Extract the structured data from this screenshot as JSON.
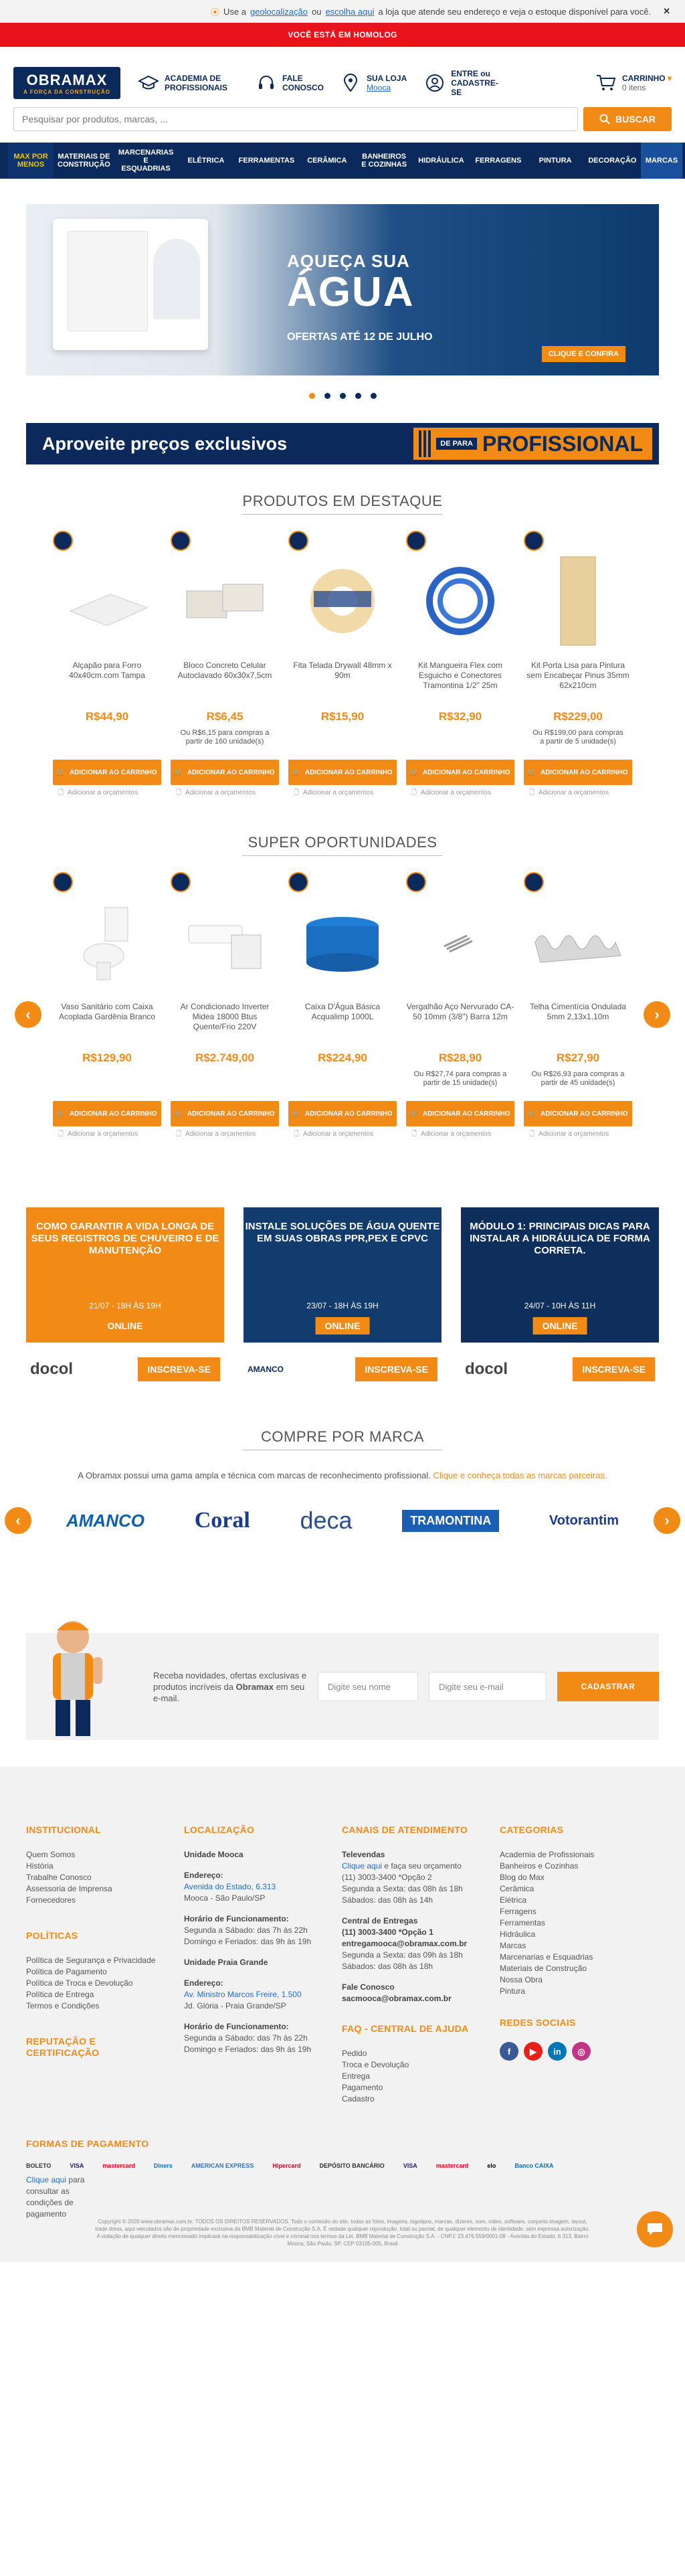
{
  "topbar": {
    "pre": "Use a",
    "geo": "geolocalização",
    "mid": "ou",
    "choose": "escolha aqui",
    "post": "a loja que atende seu endereço e veja o estoque disponível para você."
  },
  "homolog": "VOCÊ ESTÁ EM HOMOLOG",
  "header": {
    "logo": "OBRAMAX",
    "logo_sub": "A FORÇA DA CONSTRUÇÃO",
    "academia": "ACADEMIA DE PROFISSIONAIS",
    "fale": "FALE CONOSCO",
    "loja_label": "SUA LOJA",
    "loja_value": "Mooca",
    "entre": "ENTRE ou CADASTRE-SE",
    "cart_label": "CARRINHO",
    "cart_count": "0 itens"
  },
  "search": {
    "placeholder": "Pesquisar por produtos, marcas, ...",
    "button": "BUSCAR"
  },
  "nav": [
    "MAX POR MENOS",
    "MATERIAIS DE CONSTRUÇÃO",
    "MARCENARIAS E ESQUADRIAS",
    "ELÉTRICA",
    "FERRAMENTAS",
    "CERÂMICA",
    "BANHEIROS E COZINHAS",
    "HIDRÁULICA",
    "FERRAGENS",
    "PINTURA",
    "DECORAÇÃO",
    "MARCAS"
  ],
  "banner": {
    "t1": "AQUEÇA SUA",
    "t2": "ÁGUA",
    "t3": "OFERTAS ATÉ 12 DE JULHO",
    "cta": "CLIQUE E CONFIRA"
  },
  "pro_banner": {
    "text": "Aproveite preços exclusivos",
    "de": "DE PARA",
    "pro": "PROFISSIONAL"
  },
  "destaque": {
    "title": "PRODUTOS EM DESTAQUE",
    "products": [
      {
        "name": "Alçapão para Forro 40x40cm.com Tampa",
        "price": "R$44,90",
        "bulk1": "",
        "bulk2": ""
      },
      {
        "name": "Bloco Concreto Celular Autoclavado 60x30x7,5cm",
        "price": "R$6,45",
        "bulk1": "Ou R$6,15 para compras a",
        "bulk2": "partir de 160 unidade(s)"
      },
      {
        "name": "Fita Telada Drywall 48mm x 90m",
        "price": "R$15,90",
        "bulk1": "",
        "bulk2": ""
      },
      {
        "name": "Kit Mangueira Flex com Esguicho e Conectores Tramontina 1/2\" 25m",
        "price": "R$32,90",
        "bulk1": "",
        "bulk2": ""
      },
      {
        "name": "Kit Porta Lisa para Pintura sem Encabeçar Pinus 35mm 62x210cm",
        "price": "R$229,00",
        "bulk1": "Ou R$199,00 para compras",
        "bulk2": "a partir de 5 unidade(s)"
      }
    ],
    "add_label": "ADICIONAR AO CARRINHO",
    "quote_label": "Adicionar a orçamentos"
  },
  "oport": {
    "title": "SUPER OPORTUNIDADES",
    "products": [
      {
        "name": "Vaso Sanitário com Caixa Acoplada Gardênia Branco",
        "price": "R$129,90",
        "bulk1": "",
        "bulk2": ""
      },
      {
        "name": "Ar Condicionado Inverter Midea 18000 Btus Quente/Frio 220V",
        "price": "R$2.749,00",
        "bulk1": "",
        "bulk2": ""
      },
      {
        "name": "Caixa D'Água Básica Acqualimp 1000L",
        "price": "R$224,90",
        "bulk1": "",
        "bulk2": ""
      },
      {
        "name": "Vergalhão Aço Nervurado CA-50 10mm (3/8\") Barra 12m",
        "price": "R$28,90",
        "bulk1": "Ou R$27,74 para compras a",
        "bulk2": "partir de 15 unidade(s)"
      },
      {
        "name": "Telha Cimentícia Ondulada 5mm 2,13x1,10m",
        "price": "R$27,90",
        "bulk1": "Ou R$26,93 para compras a",
        "bulk2": "partir de 45 unidade(s)"
      }
    ]
  },
  "courses": [
    {
      "title": "COMO GARANTIR A VIDA LONGA DE SEUS REGISTROS DE CHUVEIRO E DE MANUTENÇÃO",
      "date": "21/07 - 18H ÀS 19H",
      "online": "ONLINE",
      "brand": "docol",
      "cta": "INSCREVA-SE",
      "bg": "#f28a16"
    },
    {
      "title": "INSTALE SOLUÇÕES DE ÁGUA QUENTE EM SUAS OBRAS PPR,PEX E CPVC",
      "date": "23/07 - 18H ÀS 19H",
      "online": "ONLINE",
      "brand": "AMANCO",
      "cta": "INSCREVA-SE",
      "bg": "#123c6e"
    },
    {
      "title": "MÓDULO 1: PRINCIPAIS DICAS PARA INSTALAR A HIDRÁULICA DE FORMA CORRETA.",
      "date": "24/07 - 10H ÀS 11H",
      "online": "ONLINE",
      "brand": "docol",
      "cta": "INSCREVA-SE",
      "bg": "#0e2f5c"
    }
  ],
  "marcas": {
    "title": "COMPRE POR MARCA",
    "desc": "A Obramax possui uma gama ampla e técnica com marcas de reconhecimento profissional.",
    "desc_link": "Clique e conheça todas as marcas parceiras.",
    "brands": [
      "AMANCO",
      "Coral",
      "deca",
      "TRAMONTINA",
      "Votorantim"
    ]
  },
  "newsletter": {
    "text1": "Receba novidades, ofertas exclusivas e produtos incríveis da",
    "brand": "Obramax",
    "text2": "em seu e-mail.",
    "name_ph": "Digite seu nome",
    "email_ph": "Digite seu e-mail",
    "button": "CADASTRAR"
  },
  "footer": {
    "institucional": {
      "title": "INSTITUCIONAL",
      "links": [
        "Quem Somos",
        "História",
        "Trabalhe Conosco",
        "Assessoria de Imprensa",
        "Fornecedores"
      ]
    },
    "politicas": {
      "title": "POLÍTICAS",
      "links": [
        "Política de Segurança e Privacidade",
        "Política de Pagamento",
        "Política de Troca e Devolução",
        "Política de Entrega",
        "Termos e Condições"
      ]
    },
    "reputacao": "REPUTAÇÃO E CERTIFICAÇÃO",
    "localizacao": {
      "title": "LOCALIZAÇÃO",
      "u1": "Unidade Mooca",
      "end": "Endereço:",
      "u1_addr": "Avenida do Estado, 6.313",
      "u1_city": "Mooca - São Paulo/SP",
      "hf": "Horário de Funcionamento:",
      "h1": "Segunda a Sábado: das 7h às 22h",
      "h2": "Domingo e Feriados: das 9h às 19h",
      "u2": "Unidade Praia Grande",
      "u2_addr": "Av. Ministro Marcos Freire, 1.500",
      "u2_city": "Jd. Glória - Praia Grande/SP",
      "h3": "Segunda a Sábado: das 7h às 22h",
      "h4": "Domingo e Feriados: das 9h às 19h"
    },
    "canais": {
      "title": "CANAIS DE ATENDIMENTO",
      "tv": "Televendas",
      "tv_link": "Clique aqui",
      "tv_text": "e faça seu orçamento",
      "tv_phone": "(11) 3003-3400 *Opção 2",
      "tv_h1": "Segunda a Sexta: das 08h às 18h",
      "tv_h2": "Sábados: das 08h às 14h",
      "ce": "Central de Entregas",
      "ce_phone": "(11) 3003-3400 *Opção 1",
      "ce_mail": "entregamooca@obramax.com.br",
      "ce_h1": "Segunda a Sexta: das 09h às 18h",
      "ce_h2": "Sábados: das 08h às 18h",
      "fc": "Fale Conosco",
      "fc_mail": "sacmooca@obramax.com.br",
      "faq": "FAQ - CENTRAL DE AJUDA",
      "faq_links": [
        "Pedido",
        "Troca e Devolução",
        "Entrega",
        "Pagamento",
        "Cadastro"
      ]
    },
    "categorias": {
      "title": "CATEGORIAS",
      "links": [
        "Academia de Profissionais",
        "Banheiros e Cozinhas",
        "Blog do Max",
        "Cerâmica",
        "Elétrica",
        "Ferragens",
        "Ferramentas",
        "Hidráulica",
        "Marcas",
        "Marcenarias e Esquadrias",
        "Materiais de Construção",
        "Nossa Obra",
        "Pintura"
      ]
    },
    "redes": "REDES SOCIAIS",
    "pagamento": {
      "title": "FORMAS DE PAGAMENTO",
      "link": "Clique aqui",
      "link_text": "para consultar as condições de pagamento",
      "methods": [
        "BOLETO",
        "VISA",
        "mastercard",
        "Diners",
        "AMERICAN EXPRESS",
        "Hipercard",
        "DEPÓSITO BANCÁRIO",
        "VISA",
        "mastercard",
        "elo",
        "Banco CAIXA"
      ]
    },
    "copyright": "Copyright © 2020 www.obramax.com.br. TODOS OS DIREITOS RESERVADOS. Todo o conteúdo do site, todas as fotos, imagens, logotipos, marcas, dizeres, som, vídeo, software, conjunto imagem, layout, trade dress, aqui veiculados são de propriedade exclusiva da BMB Material de Construção S.A. É vedada qualquer reprodução, total ou parcial, de qualquer elemento de identidade, sem expressa autorização. A violação de qualquer direito mencionado implicará na responsabilização cível e criminal nos termos da Lei. BMB Material de Construção S.A. - CNPJ: 23.476.559/0001-08 - Avenida do Estado, 6.313, Bairro Mooca, São Paulo, SP, CEP 03105-005, Brasil"
  },
  "colors": {
    "brand_navy": "#0b2a5b",
    "accent_orange": "#f28a16",
    "homolog_red": "#e8131b"
  }
}
